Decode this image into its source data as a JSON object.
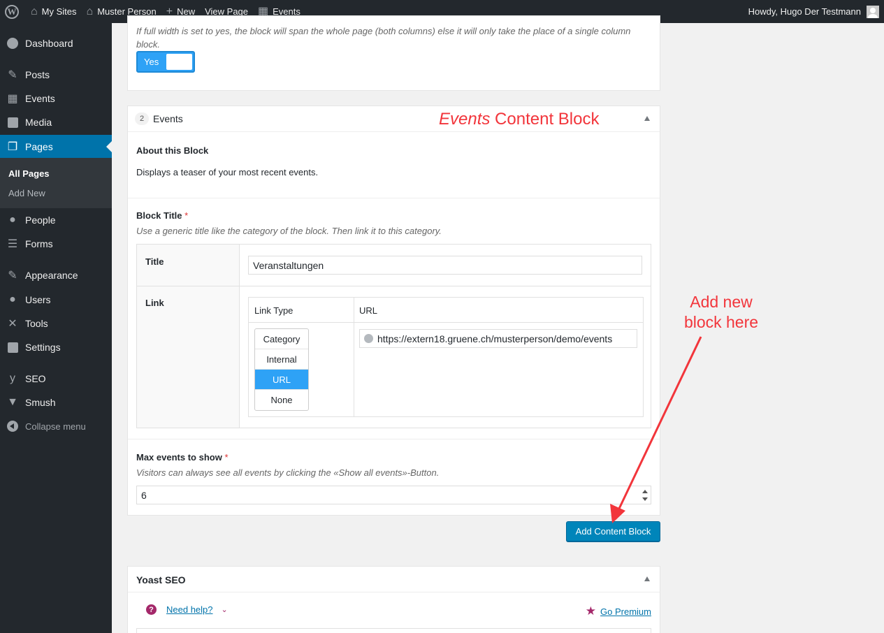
{
  "adminbar": {
    "my_sites": "My Sites",
    "site_name": "Muster Person",
    "new": "New",
    "view_page": "View Page",
    "events": "Events",
    "howdy": "Howdy, Hugo Der Testmann"
  },
  "sidebar": {
    "dashboard": "Dashboard",
    "posts": "Posts",
    "events": "Events",
    "media": "Media",
    "pages": "Pages",
    "all_pages": "All Pages",
    "add_new": "Add New",
    "people": "People",
    "forms": "Forms",
    "appearance": "Appearance",
    "users": "Users",
    "tools": "Tools",
    "settings": "Settings",
    "seo": "SEO",
    "smush": "Smush",
    "collapse": "Collapse menu"
  },
  "full_width": {
    "description": "If full width is set to yes, the block will span the whole page (both columns) else it will only take the place of a single column block.",
    "toggle_label": "Yes",
    "value": true
  },
  "events_block": {
    "number": "2",
    "title": "Events",
    "about_label": "About this Block",
    "about_text": "Displays a teaser of your most recent events.",
    "block_title_label": "Block Title",
    "required_mark": "*",
    "block_title_hint": "Use a generic title like the category of the block. Then link it to this category.",
    "title_label": "Title",
    "title_value": "Veranstaltungen",
    "link_label": "Link",
    "link_type_header": "Link Type",
    "url_header": "URL",
    "link_type_options": [
      "Category",
      "Internal",
      "URL",
      "None"
    ],
    "link_type_selected": "URL",
    "url_value": "https://extern18.gruene.ch/musterperson/demo/events",
    "max_events_label": "Max events to show",
    "max_events_hint": "Visitors can always see all events by clicking the «Show all events»-Button.",
    "max_events_value": "6"
  },
  "add_block_button": "Add Content Block",
  "yoast": {
    "title": "Yoast SEO",
    "need_help": "Need help?",
    "go_premium": "Go Premium"
  },
  "annotations": {
    "events_italic": "Events",
    "events_rest": "Content Block",
    "add_new": "Add new",
    "block_here": "block here",
    "color": "#f2353b"
  },
  "colors": {
    "admin_dark": "#23282d",
    "wp_blue": "#0073aa",
    "toggle_blue": "#2ea2f6",
    "button_blue": "#0085ba"
  }
}
